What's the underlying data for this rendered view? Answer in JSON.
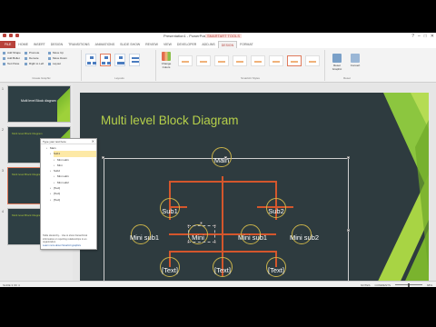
{
  "window": {
    "doc_title": "Presentation1 - PowerPoint",
    "contextual_title": "SMARTART TOOLS",
    "controls": [
      "?",
      "–",
      "□",
      "✕"
    ]
  },
  "tabs": [
    "FILE",
    "HOME",
    "INSERT",
    "DESIGN",
    "TRANSITIONS",
    "ANIMATIONS",
    "SLIDE SHOW",
    "REVIEW",
    "VIEW",
    "DEVELOPER",
    "ADD-INS",
    "DESIGN",
    "FORMAT"
  ],
  "active_tab_index": 11,
  "ribbon": {
    "create_graphic": {
      "label": "Create Graphic",
      "buttons": [
        "Add Shape",
        "Add Bullet",
        "Text Pane",
        "Promote",
        "Demote",
        "Right to Left",
        "Move Up",
        "Move Down",
        "Layout"
      ]
    },
    "layouts_label": "Layouts",
    "change_colors": "Change Colors",
    "styles_label": "SmartArt Styles",
    "reset_label": "Reset",
    "reset_buttons": [
      "Reset Graphic",
      "Convert"
    ]
  },
  "thumbnails": [
    {
      "num": "1",
      "title": "Multi level Block diagram"
    },
    {
      "num": "2",
      "title": "Multi level Block Diagram"
    },
    {
      "num": "3",
      "title": "Multi level Block Diagram"
    },
    {
      "num": "4",
      "title": "Multi level Block Diagram"
    }
  ],
  "text_pane": {
    "title": "Type your text here",
    "close": "✕",
    "items": [
      "Main",
      "Sub1",
      "Mini sub1",
      "Mini",
      "Sub2",
      "Mini sub1",
      "Mini sub2",
      "[Text]",
      "[Text]",
      "[Text]"
    ],
    "footer_text": "Table Hierarchy... Use to show hierarchical information or reporting relationships in an organization.",
    "footer_link": "Learn more about SmartArt graphics"
  },
  "slide": {
    "title": "Multi level Block Diagram",
    "nodes": {
      "main": "Main",
      "sub1": "Sub1",
      "sub2": "Sub2",
      "mini_sub1_a": "Mini sub1",
      "mini": "Mini",
      "mini_sub1_b": "Mini sub1",
      "mini_sub2": "Mini sub2",
      "text_a": "[Text]",
      "text_b": "[Text]",
      "text_c": "[Text]"
    }
  },
  "status": {
    "left": "SLIDE 3 OF 4",
    "notes": "NOTES",
    "comments": "COMMENTS",
    "zoom": "68%"
  },
  "colors": {
    "accent": "#b8423b",
    "slide_bg": "#2e3b3f",
    "title_green": "#b6d04a",
    "connector": "#d4562c",
    "node_ring": "#c9b24a"
  }
}
